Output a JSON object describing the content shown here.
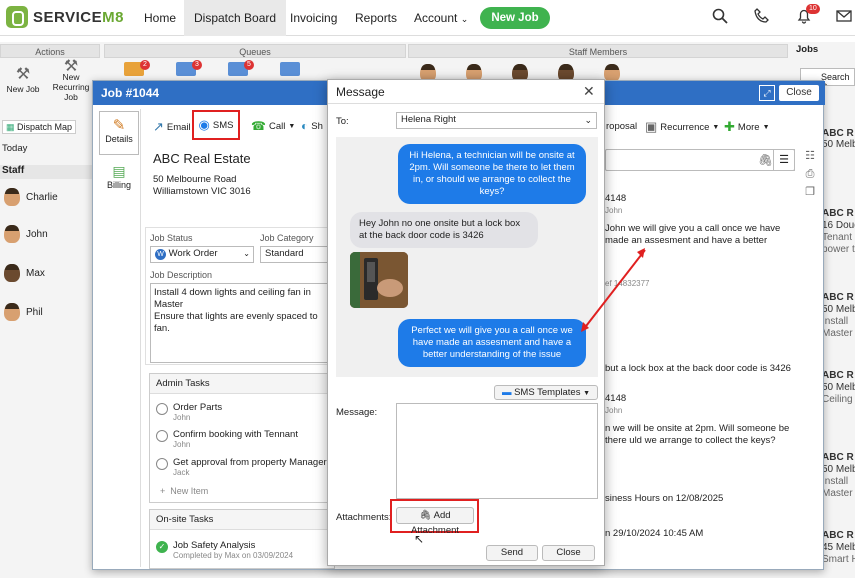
{
  "app": {
    "logo_left": "SERVICE",
    "logo_right": "M8"
  },
  "nav": {
    "home": "Home",
    "dispatch": "Dispatch Board",
    "invoicing": "Invoicing",
    "reports": "Reports",
    "account": "Account",
    "new_job": "New Job",
    "notif_count": "10"
  },
  "board": {
    "actions": "Actions",
    "queues": "Queues",
    "staff_members": "Staff Members",
    "jobs": "Jobs",
    "new_job": "New Job",
    "new_recurring": "New Recurring Job",
    "dispatch_map": "Dispatch Map",
    "today": "Today",
    "staff": "Staff",
    "search": "Search R",
    "queue_badges": [
      "2",
      "3",
      "5"
    ],
    "staff_list": [
      "Charlie",
      "John",
      "Max",
      "Phil"
    ]
  },
  "job": {
    "title": "Job #1044",
    "close": "Close",
    "tabs": {
      "details": "Details",
      "billing": "Billing"
    },
    "toolbar": {
      "email": "Email",
      "sms": "SMS",
      "call": "Call",
      "share": "Sh",
      "proposal": "roposal",
      "recurrence": "Recurrence",
      "more": "More"
    },
    "client": {
      "name": "ABC Real Estate",
      "addr1": "50 Melbourne Road",
      "addr2": "Williamstown VIC 3016"
    },
    "status_label": "Job Status",
    "status_value": "Work Order",
    "category_label": "Job Category",
    "category_value": "Standard",
    "desc_label": "Job Description",
    "desc_text": "Install 4 down lights and ceiling fan in Master\nEnsure that lights are evenly spaced to fan.",
    "admin_tasks_label": "Admin Tasks",
    "admin_tasks": [
      {
        "title": "Order Parts",
        "who": "John"
      },
      {
        "title": "Confirm booking with Tennant",
        "who": "John"
      },
      {
        "title": "Get approval from property Manager",
        "who": "Jack"
      }
    ],
    "new_item": "New Item",
    "onsite_label": "On-site Tasks",
    "onsite_task": {
      "title": "Job Safety Analysis",
      "who": "Completed by Max on 03/09/2024"
    },
    "feed": {
      "id1": "4148",
      "by1": "John",
      "msg1": "John we will give you a call once we have made an assesment and have a better understanding of the issue",
      "ref": "ef 14832377",
      "msg2": "but a lock box at the back door code is 3426",
      "id2": "4148",
      "by2": "John",
      "msg3": "n we will be onsite at 2pm. Will someone be there uld we arrange to collect the keys?",
      "hours": "siness Hours on 12/08/2025",
      "date": "n 29/10/2024 10:45 AM"
    }
  },
  "message": {
    "title": "Message",
    "to_label": "To:",
    "to_value": "Helena Right",
    "bubbles": [
      "Hi Helena, a technician will be onsite at 2pm. Will someone be there to let them in, or should we arrange to collect the keys?",
      "Hey John no one onsite but a lock box at the back door code is 3426",
      "Perfect we will give you a call once we have made an assesment and have a better understanding of the issue"
    ],
    "templates": "SMS Templates",
    "message_label": "Message:",
    "attachments_label": "Attachments:",
    "add_attachment": "Add Attachment",
    "send": "Send",
    "close": "Close"
  },
  "right_cards": [
    {
      "t": "ABC R",
      "l1": "50 Melb",
      "l2": ""
    },
    {
      "t": "ABC R",
      "l1": "16 Doug",
      "l2": "Tenant",
      "l3": "power t"
    },
    {
      "t": "ABC R",
      "l1": "50 Melb",
      "l2": "Install",
      "l3": "Master"
    },
    {
      "t": "ABC R",
      "l1": "50 Melb",
      "l2": "Ceiling"
    },
    {
      "t": "ABC R",
      "l1": "50 Melb",
      "l2": "Install",
      "l3": "Master"
    },
    {
      "t": "ABC R",
      "l1": "45 Melb",
      "l2": "Smart H"
    }
  ],
  "colors": {
    "brand_green": "#3fb34f",
    "title_blue": "#2f6fc4",
    "sms_blue": "#1e7be8",
    "highlight_red": "#e02020"
  }
}
